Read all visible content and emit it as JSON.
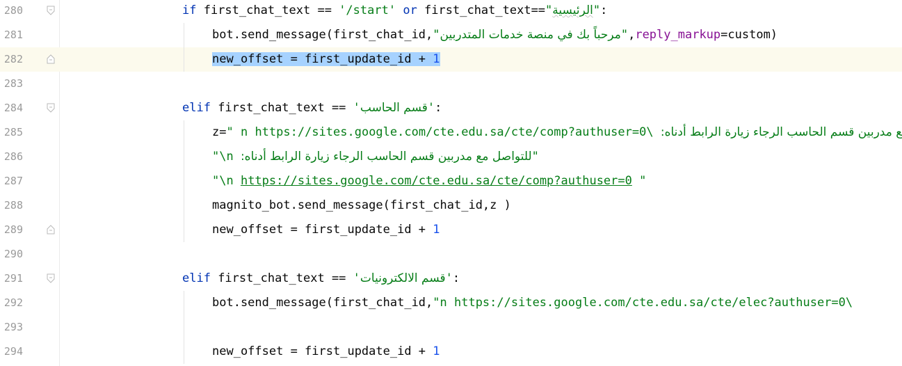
{
  "editor": {
    "current_line": "282",
    "lines": [
      {
        "num": "280",
        "indent": 1,
        "fold": "open",
        "tokens": [
          {
            "c": "kw",
            "t": "if"
          },
          {
            "c": "",
            "t": " first_chat_text == "
          },
          {
            "c": "str",
            "t": "'/start'"
          },
          {
            "c": "",
            "t": " "
          },
          {
            "c": "kw",
            "t": "or"
          },
          {
            "c": "",
            "t": " first_chat_text=="
          },
          {
            "c": "str",
            "t": "\""
          },
          {
            "c": "str rtl weak",
            "t": "الرئيسية"
          },
          {
            "c": "str",
            "t": "\""
          },
          {
            "c": "",
            "t": ":"
          }
        ]
      },
      {
        "num": "281",
        "indent": 2,
        "tokens": [
          {
            "c": "",
            "t": "bot.send_message(first_chat_id,"
          },
          {
            "c": "str",
            "t": "\""
          },
          {
            "c": "str rtl",
            "t": "مرحباً بك في منصة خدمات المتدربين"
          },
          {
            "c": "str",
            "t": "\""
          },
          {
            "c": "",
            "t": ","
          },
          {
            "c": "param",
            "t": "reply_markup"
          },
          {
            "c": "",
            "t": "=custom)"
          }
        ]
      },
      {
        "num": "282",
        "indent": 2,
        "fold": "close",
        "current": true,
        "tokens": [
          {
            "c": "sel",
            "t": "new_offset = first_update_id + "
          },
          {
            "c": "num sel",
            "t": "1"
          }
        ]
      },
      {
        "num": "283",
        "indent": 0,
        "tokens": []
      },
      {
        "num": "284",
        "indent": 1,
        "fold": "open",
        "tokens": [
          {
            "c": "kw",
            "t": "elif"
          },
          {
            "c": "",
            "t": " first_chat_text == "
          },
          {
            "c": "str",
            "t": "'"
          },
          {
            "c": "str rtl",
            "t": "قسم الحاسب"
          },
          {
            "c": "str",
            "t": "'"
          },
          {
            "c": "",
            "t": ":"
          }
        ]
      },
      {
        "num": "285",
        "indent": 2,
        "tokens": [
          {
            "c": "",
            "t": "z="
          },
          {
            "c": "str",
            "t": "\" n "
          },
          {
            "c": "str",
            "t": "https://sites.google.com/cte.edu.sa/cte/comp?authuser=0\\"
          },
          {
            "c": "str",
            "t": " "
          },
          {
            "c": "str rtl",
            "t": "للتواصل مع مدربين قسم الحاسب الرجاء زيارة الرابط أدناه:"
          }
        ]
      },
      {
        "num": "286",
        "indent": 2,
        "tokens": [
          {
            "c": "str",
            "t": "\"\\n "
          },
          {
            "c": "str rtl",
            "t": "للتواصل مع مدربين قسم الحاسب الرجاء زيارة الرابط أدناه:"
          },
          {
            "c": "str",
            "t": "\""
          }
        ]
      },
      {
        "num": "287",
        "indent": 2,
        "tokens": [
          {
            "c": "str",
            "t": "\"\\n "
          },
          {
            "c": "link",
            "t": "https://sites.google.com/cte.edu.sa/cte/comp?authuser=0"
          },
          {
            "c": "str",
            "t": " \""
          }
        ]
      },
      {
        "num": "288",
        "indent": 2,
        "tokens": [
          {
            "c": "",
            "t": "magnito_bot.send_message(first_chat_id,z )"
          }
        ]
      },
      {
        "num": "289",
        "indent": 2,
        "fold": "close",
        "tokens": [
          {
            "c": "",
            "t": "new_offset = first_update_id + "
          },
          {
            "c": "num",
            "t": "1"
          }
        ]
      },
      {
        "num": "290",
        "indent": 0,
        "tokens": []
      },
      {
        "num": "291",
        "indent": 1,
        "fold": "open",
        "tokens": [
          {
            "c": "kw",
            "t": "elif"
          },
          {
            "c": "",
            "t": " first_chat_text == "
          },
          {
            "c": "str",
            "t": "'"
          },
          {
            "c": "str rtl",
            "t": "قسم الالكترونيات"
          },
          {
            "c": "str",
            "t": "'"
          },
          {
            "c": "",
            "t": ":"
          }
        ]
      },
      {
        "num": "292",
        "indent": 2,
        "tokens": [
          {
            "c": "",
            "t": "bot.send_message(first_chat_id,"
          },
          {
            "c": "str",
            "t": "\"n https://sites.google.com/cte.edu.sa/cte/elec?authuser=0\\"
          }
        ]
      },
      {
        "num": "293",
        "indent": 0,
        "tokens": []
      },
      {
        "num": "294",
        "indent": 2,
        "tokens": [
          {
            "c": "",
            "t": "new_offset = first_update_id + "
          },
          {
            "c": "num",
            "t": "1"
          }
        ]
      }
    ]
  }
}
